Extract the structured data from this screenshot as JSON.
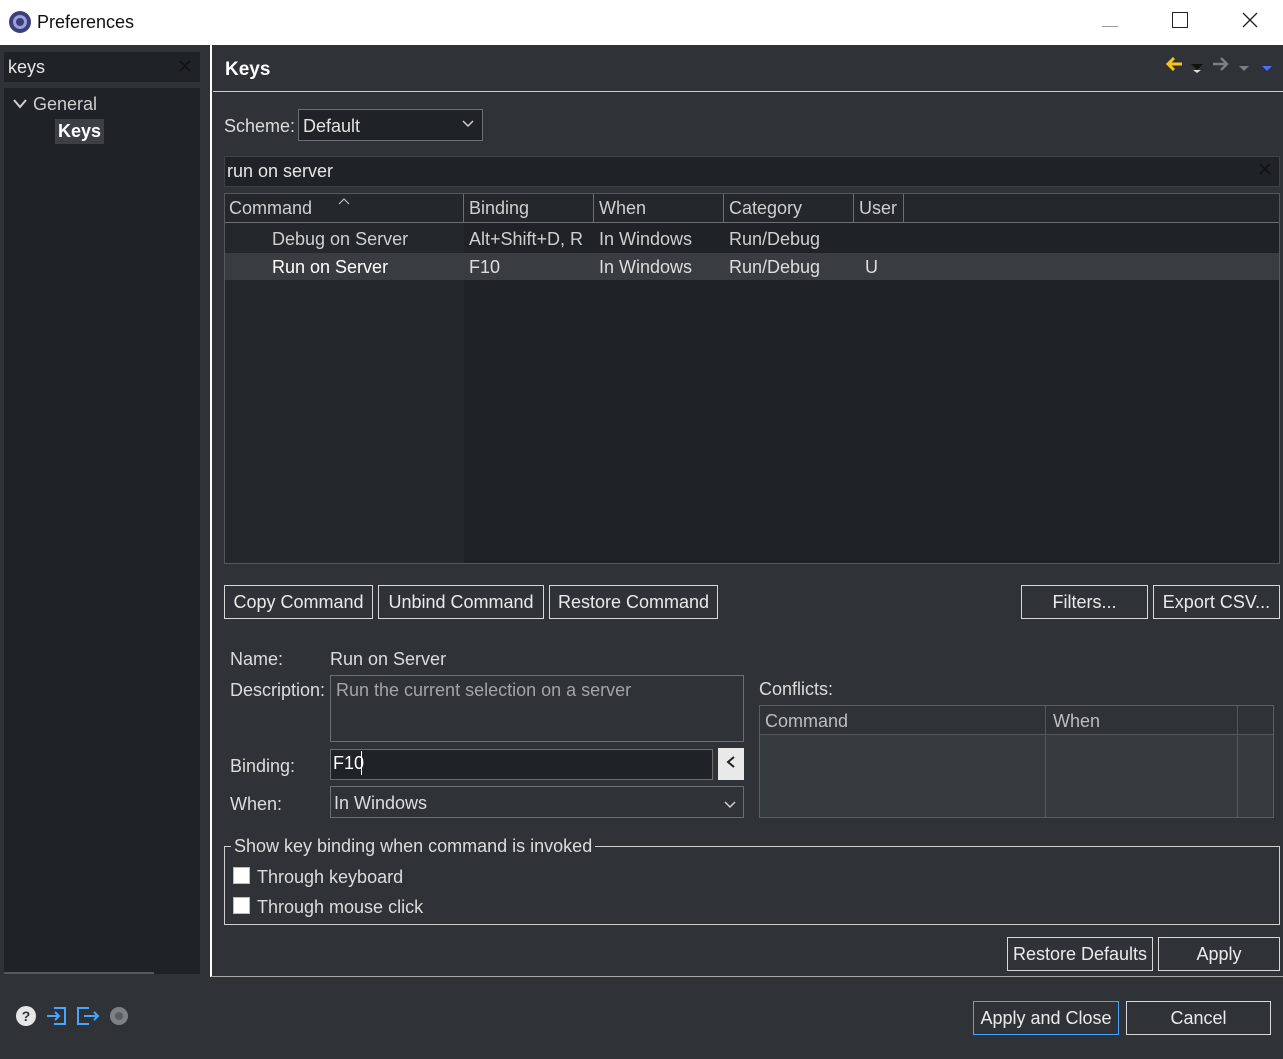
{
  "window": {
    "title": "Preferences"
  },
  "left": {
    "filter_value": "keys",
    "tree": {
      "general": "General",
      "keys": "Keys"
    }
  },
  "page": {
    "title": "Keys",
    "scheme_label": "Scheme:",
    "scheme_value": "Default",
    "search_value": "run on server"
  },
  "table": {
    "columns": [
      "Command",
      "Binding",
      "When",
      "Category",
      "User"
    ],
    "rows": [
      {
        "command": "Debug on Server",
        "binding": "Alt+Shift+D, R",
        "when": "In Windows",
        "category": "Run/Debug",
        "user": ""
      },
      {
        "command": "Run on Server",
        "binding": "F10",
        "when": "In Windows",
        "category": "Run/Debug",
        "user": "U"
      }
    ]
  },
  "buttons": {
    "copy": "Copy Command",
    "unbind": "Unbind Command",
    "restore": "Restore Command",
    "filters": "Filters...",
    "export": "Export CSV...",
    "restore_defaults": "Restore Defaults",
    "apply": "Apply",
    "apply_close": "Apply and Close",
    "cancel": "Cancel"
  },
  "details": {
    "name_label": "Name:",
    "name_value": "Run on Server",
    "description_label": "Description:",
    "description_value": "Run the current selection on a server",
    "binding_label": "Binding:",
    "binding_value": "F10",
    "when_label": "When:",
    "when_value": "In Windows",
    "conflicts_label": "Conflicts:",
    "conflicts_columns": [
      "Command",
      "When"
    ]
  },
  "show_binding": {
    "legend": "Show key binding when command is invoked",
    "through_keyboard": "Through keyboard",
    "through_mouse": "Through mouse click"
  },
  "colors": {
    "accent_nav": "#f5c518",
    "link_blue": "#4aa3ff"
  }
}
